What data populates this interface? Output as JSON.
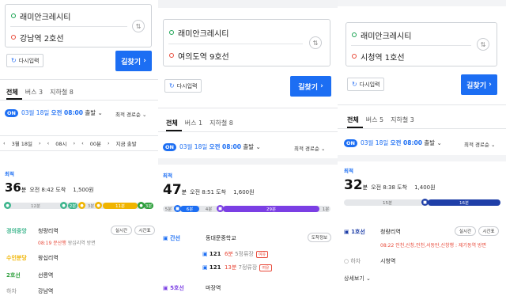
{
  "panels": [
    {
      "origin": "래미안크레시티",
      "destination": "강남역 2호선",
      "retry_label": "다시입력",
      "search_label": "길찾기",
      "tabs": [
        "전체",
        "버스 3",
        "지하철 8"
      ],
      "date_on": "ON",
      "date_text": "03월 18일",
      "time_text": "오전 08:00",
      "date_suffix": "출발",
      "sort_label": "최적 경로순",
      "timeline": [
        "3월 18일",
        "08시",
        "00분",
        "지금 출발"
      ],
      "best_label": "최적",
      "duration": "36",
      "duration_unit": "분",
      "arrive": "오전 8:42 도착",
      "fare": "1,500원",
      "bar_labels": [
        "12분",
        "2분",
        "3분",
        "11분",
        "3분"
      ],
      "steps": [
        {
          "line": "경의중앙",
          "station": "청량리역",
          "color": "#3fb68e"
        },
        {
          "line": "수인분당",
          "station": "왕십리역",
          "color": "#f0b400"
        },
        {
          "line": "2호선",
          "station": "선릉역",
          "color": "#2e9f3c"
        },
        {
          "line": "하차",
          "station": "강남역",
          "color": "#888888"
        }
      ],
      "step1_sub": "08:19 문산행",
      "step1_sub2": "왕십리역 방면",
      "pill1": "실시간",
      "pill2": "시간표"
    },
    {
      "origin": "래미안크레시티",
      "destination": "여의도역 9호선",
      "retry_label": "다시입력",
      "search_label": "길찾기",
      "tabs": [
        "전체",
        "버스 1",
        "지하철 8"
      ],
      "date_on": "ON",
      "date_text": "03월 18일",
      "time_text": "오전 08:00",
      "date_suffix": "출발",
      "sort_label": "최적 경로순",
      "best_label": "최적",
      "duration": "47",
      "duration_unit": "분",
      "arrive": "오전 8:51 도착",
      "fare": "1,600원",
      "bar_labels": [
        "5분",
        "6분",
        "4분",
        "29분",
        "1분"
      ],
      "bus_type": "간선",
      "bus_station": "동대문중학교",
      "bus_btn": "도착정보",
      "buses": [
        {
          "no": "121",
          "eta": "6분",
          "stops": "5정류장",
          "tag": "여유"
        },
        {
          "no": "121",
          "eta": "13분",
          "stops": "7정류장",
          "tag": "여유"
        }
      ],
      "next_line": "5호선",
      "next_station": "마장역"
    },
    {
      "origin": "래미안크레시티",
      "destination": "시청역 1호선",
      "retry_label": "다시입력",
      "search_label": "길찾기",
      "tabs": [
        "전체",
        "버스 5",
        "지하철 3"
      ],
      "date_on": "ON",
      "date_text": "03월 18일",
      "time_text": "오전 08:00",
      "date_suffix": "출발",
      "sort_label": "최적 경로순",
      "best_label": "최적",
      "duration": "32",
      "duration_unit": "분",
      "arrive": "오전 8:38 도착",
      "fare": "1,400원",
      "bar_labels": [
        "15분",
        "16분"
      ],
      "step1_line": "1호선",
      "step1_station": "청량리역",
      "pill1": "실시간",
      "pill2": "시간표",
      "step1_sub": "08:22 인천,신창,인천,서동탄,신창행 : 제기동역 방면",
      "exit_label": "하차",
      "exit_station": "시청역",
      "detail_link": "상세보기"
    }
  ],
  "colors": {
    "accent": "#1c6ef3",
    "red": "#e84a3a",
    "green": "#19a352",
    "purple": "#7b3fe4",
    "line1": "#1f3fa8"
  }
}
